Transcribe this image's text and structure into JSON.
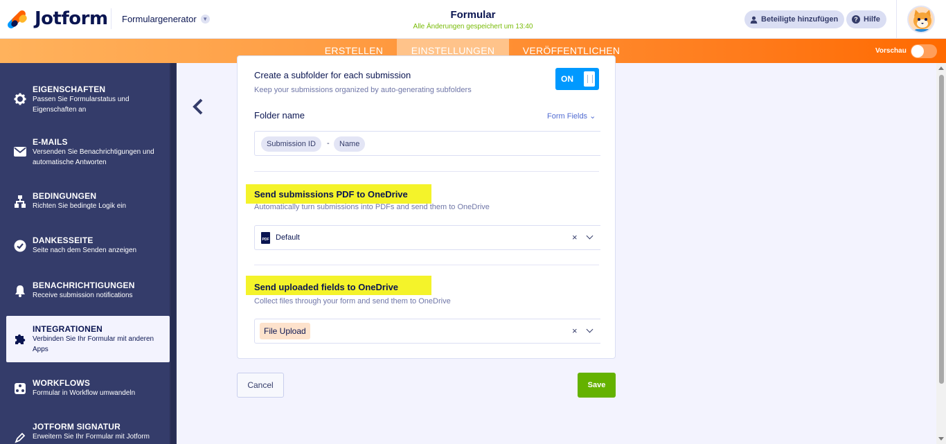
{
  "header": {
    "brand": "Jotform",
    "form_generator": "Formulargenerator",
    "form_title": "Formular",
    "save_status": "Alle Änderungen gespeichert um 13:40",
    "add_participants": "Beteiligte hinzufügen",
    "help": "Hilfe"
  },
  "nav": {
    "tabs": [
      {
        "label": "ERSTELLEN"
      },
      {
        "label": "EINSTELLUNGEN"
      },
      {
        "label": "VERÖFFENTLICHEN"
      }
    ],
    "preview_label": "Vorschau"
  },
  "sidebar": {
    "items": [
      {
        "title": "EIGENSCHAFTEN",
        "desc": "Passen Sie Formularstatus und Eigenschaften an",
        "icon": "gear-icon"
      },
      {
        "title": "E-MAILS",
        "desc": "Versenden Sie Benachrichtigungen und automatische Antworten",
        "icon": "envelope-icon"
      },
      {
        "title": "BEDINGUNGEN",
        "desc": "Richten Sie bedingte Logik ein",
        "icon": "logic-tree-icon"
      },
      {
        "title": "DANKESSEITE",
        "desc": "Seite nach dem Senden anzeigen",
        "icon": "check-circle-icon"
      },
      {
        "title": "BENACHRICHTIGUNGEN",
        "desc": "Receive submission notifications",
        "icon": "bell-icon"
      },
      {
        "title": "INTEGRATIONEN",
        "desc": "Verbinden Sie Ihr Formular mit anderen Apps",
        "icon": "puzzle-icon"
      },
      {
        "title": "WORKFLOWS",
        "desc": "Formular in Workflow umwandeln",
        "icon": "workflow-icon"
      },
      {
        "title": "JOTFORM SIGNATUR",
        "desc": "Erweitern Sie Ihr Formular mit Jotform",
        "icon": "pen-icon"
      }
    ]
  },
  "card": {
    "subfolder_title": "Create a subfolder for each submission",
    "subfolder_desc": "Keep your submissions organized by auto-generating subfolders",
    "toggle_label": "ON",
    "folder_name_label": "Folder name",
    "form_fields_label": "Form Fields",
    "folder_chips": [
      "Submission ID",
      "Name"
    ],
    "folder_separator": "-",
    "pdf_title": "Send submissions PDF to OneDrive",
    "pdf_desc": "Automatically turn submissions into PDFs and send them to OneDrive",
    "pdf_select_value": "Default",
    "pdf_icon_text": "PDF",
    "upload_title": "Send uploaded fields to OneDrive",
    "upload_desc": "Collect files through your form and send them to OneDrive",
    "upload_select_value": "File Upload",
    "clear_symbol": "×"
  },
  "actions": {
    "cancel": "Cancel",
    "save": "Save"
  },
  "colors": {
    "sidebar_bg": "#343c6a",
    "accent_orange": "#ff7a1a",
    "highlight": "#f4f32a",
    "toggle_blue": "#0099ff",
    "save_green": "#64b200",
    "status_green": "#78bb07"
  }
}
